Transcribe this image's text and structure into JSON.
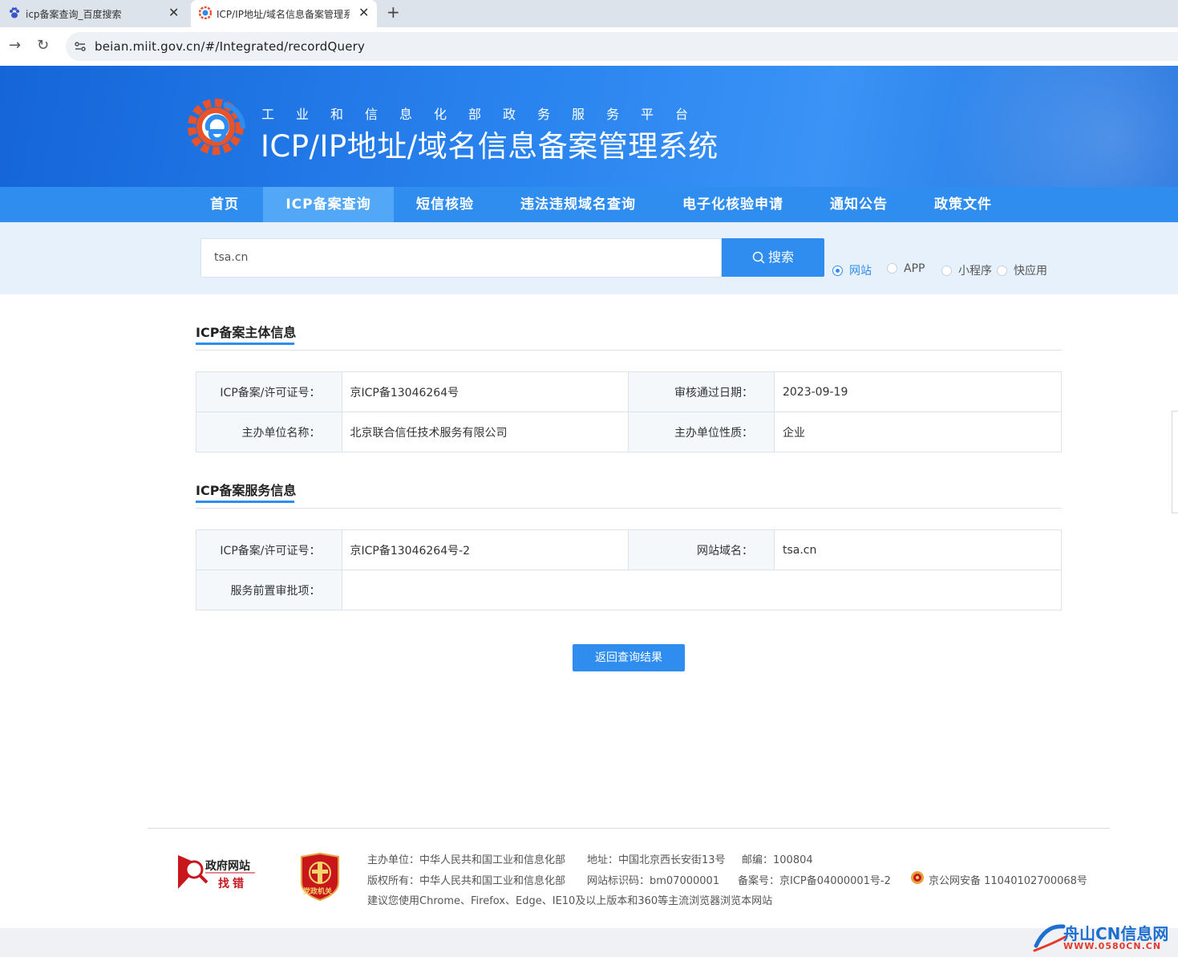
{
  "browser": {
    "tabs": [
      {
        "title": "icp备案查询_百度搜索",
        "active": false
      },
      {
        "title": "ICP/IP地址/域名信息备案管理系",
        "active": true
      }
    ],
    "url": "beian.miit.gov.cn/#/Integrated/recordQuery"
  },
  "header": {
    "platform": "工业和信息化部政务服务平台",
    "title": "ICP/IP地址/域名信息备案管理系统"
  },
  "nav": {
    "items": [
      {
        "label": "首页"
      },
      {
        "label": "ICP备案查询"
      },
      {
        "label": "短信核验"
      },
      {
        "label": "违法违规域名查询"
      },
      {
        "label": "电子化核验申请"
      },
      {
        "label": "通知公告"
      },
      {
        "label": "政策文件"
      }
    ],
    "active": "ICP备案查询"
  },
  "search": {
    "value": "tsa.cn",
    "button": "搜索",
    "options": [
      "网站",
      "APP",
      "小程序",
      "快应用"
    ],
    "selected": "网站"
  },
  "subject": {
    "title": "ICP备案主体信息",
    "license_label": "ICP备案/许可证号：",
    "license_value": "京ICP备13046264号",
    "date_label": "审核通过日期：",
    "date_value": "2023-09-19",
    "org_label": "主办单位名称：",
    "org_value": "北京联合信任技术服务有限公司",
    "nature_label": "主办单位性质：",
    "nature_value": "企业"
  },
  "service": {
    "title": "ICP备案服务信息",
    "license_label": "ICP备案/许可证号：",
    "license_value": "京ICP备13046264号-2",
    "domain_label": "网站域名：",
    "domain_value": "tsa.cn",
    "approval_label": "服务前置审批项：",
    "approval_value": ""
  },
  "back_button": "返回查询结果",
  "footer": {
    "gov_logo_top": "政府网站",
    "gov_logo_bottom": "找错",
    "party_logo": "党政机关",
    "host": "主办单位：中华人民共和国工业和信息化部",
    "address": "地址：中国北京西长安街13号",
    "postcode": "邮编：100804",
    "copyright": "版权所有：中华人民共和国工业和信息化部",
    "site_id": "网站标识码：bm07000001",
    "icp": "备案号：京ICP备04000001号-2",
    "police": "京公网安备 11040102700068号",
    "browser_tip": "建议您使用Chrome、Firefox、Edge、IE10及以上版本和360等主流浏览器浏览本网站"
  },
  "watermark": {
    "name": "舟山CN信息网",
    "url": "WWW.0580CN.CN"
  },
  "colors": {
    "primary": "#2f8df0",
    "header_dark": "#1565d8",
    "search_band": "#e6f1fc"
  }
}
